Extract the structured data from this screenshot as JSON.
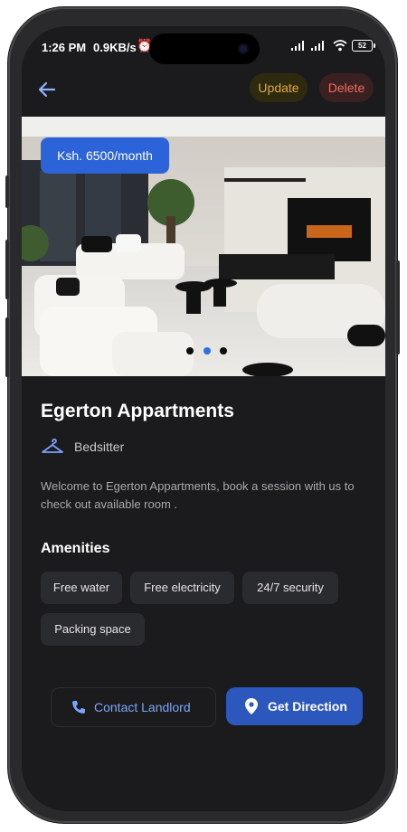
{
  "status_bar": {
    "time": "1:26 PM",
    "speed": "0.9KB/s",
    "alarm": "⏰",
    "battery": "52"
  },
  "toolbar": {
    "update_label": "Update",
    "delete_label": "Delete"
  },
  "listing": {
    "price": "Ksh. 6500/month",
    "title": "Egerton Appartments",
    "type": "Bedsitter",
    "description": "Welcome to Egerton Appartments, book a session with us to check out available room .",
    "carousel": {
      "total": 3,
      "active_index": 1
    }
  },
  "amenities": {
    "heading": "Amenities",
    "items": [
      "Free water",
      "Free electricity",
      "24/7 security",
      "Packing space"
    ]
  },
  "actions": {
    "contact_label": "Contact Landlord",
    "direction_label": "Get Direction"
  },
  "colors": {
    "accent": "#2c63d9",
    "update": "#e3a93a",
    "delete": "#ef6b5e",
    "background": "#1b1b1d"
  }
}
